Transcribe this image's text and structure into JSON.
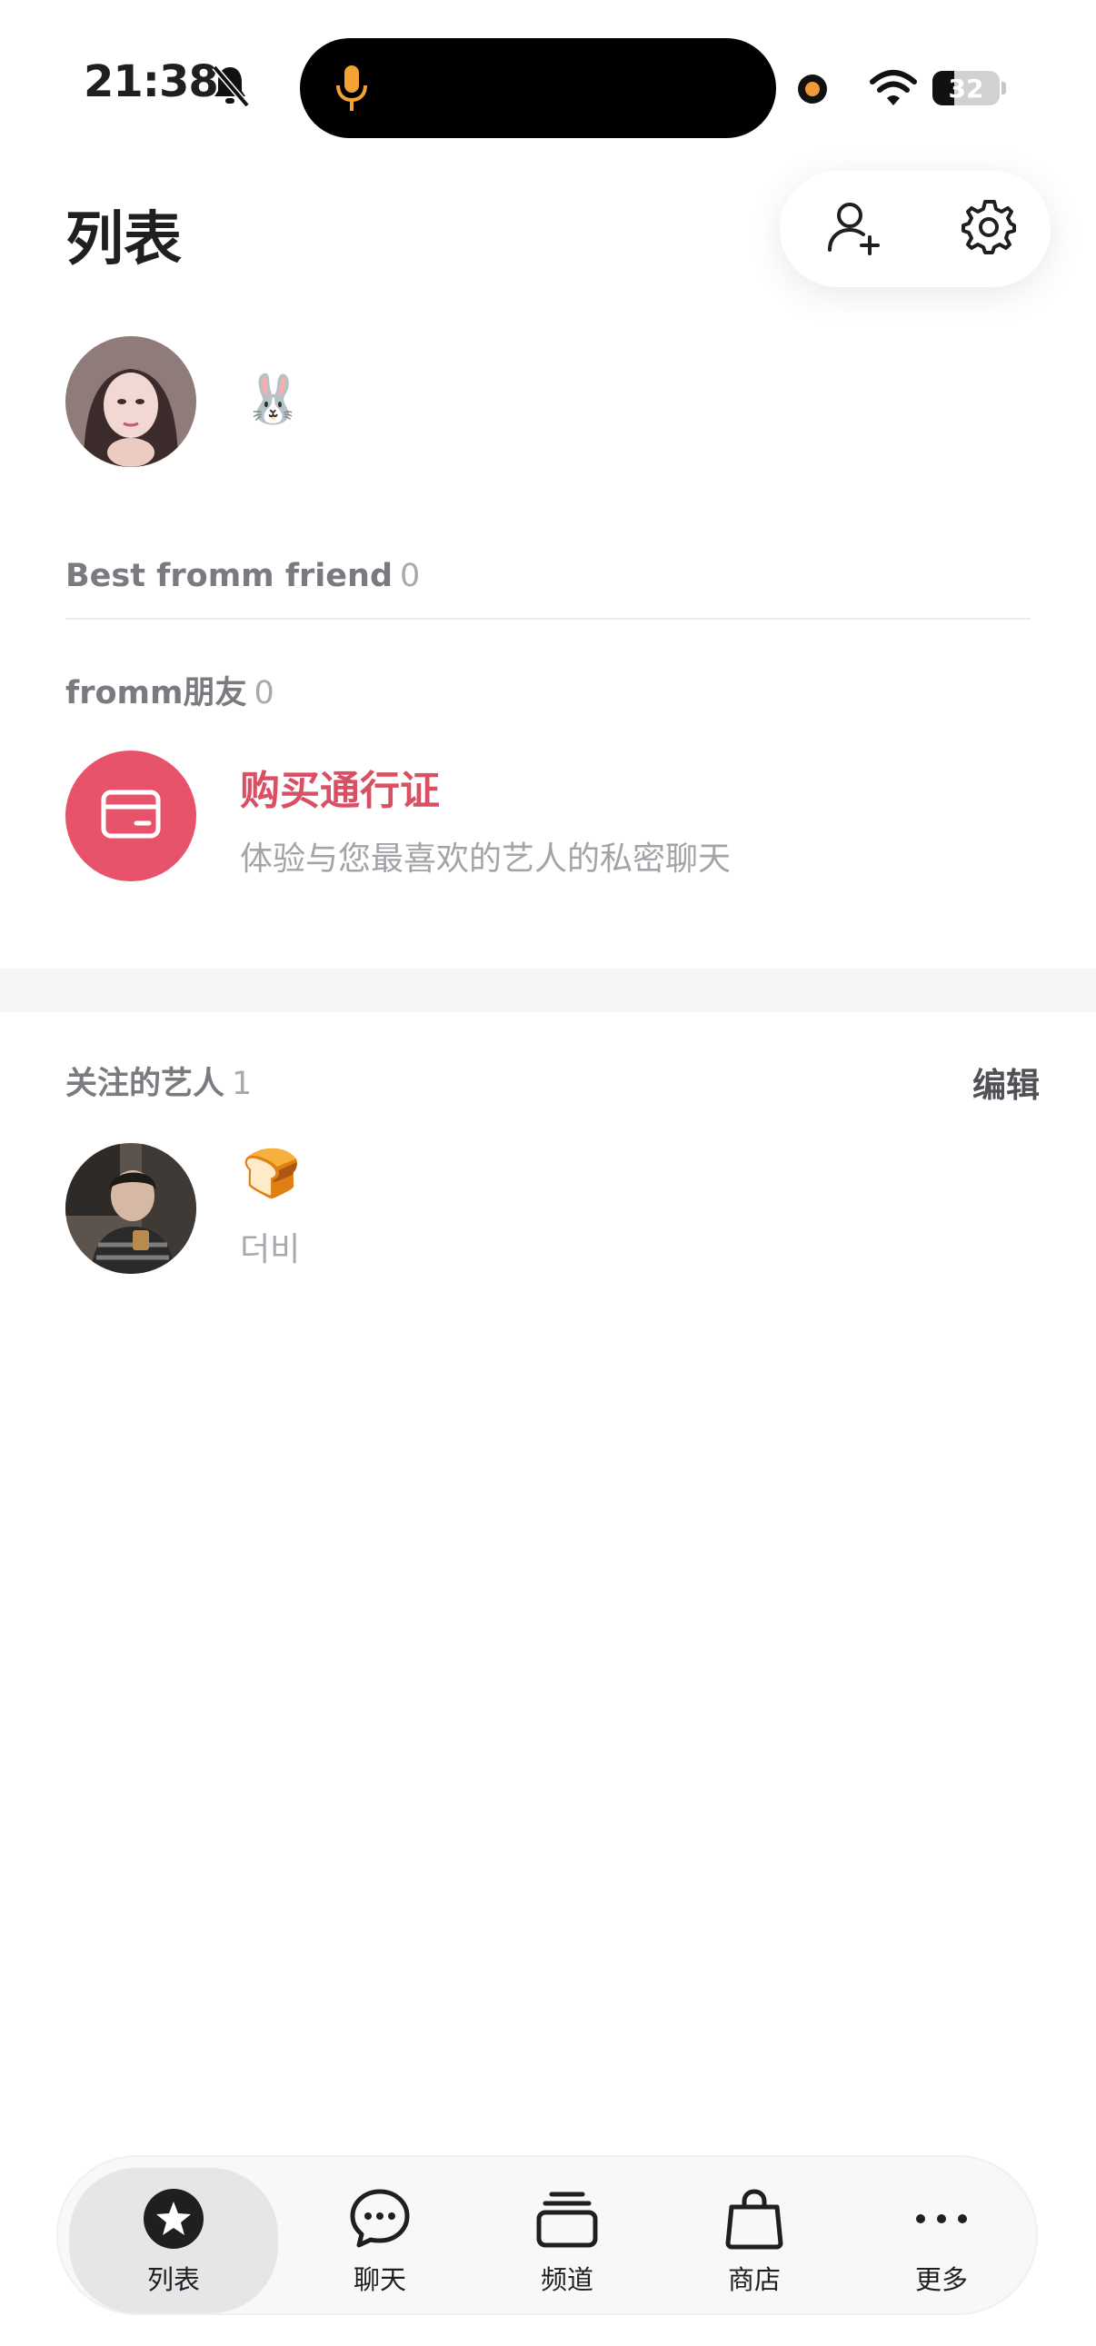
{
  "status_bar": {
    "time": "21:38",
    "battery_level": "32",
    "battery_fraction": 0.32
  },
  "header": {
    "title": "列表"
  },
  "profile": {
    "emoji": "🐰"
  },
  "best_friends": {
    "label": "Best fromm friend",
    "count": "0"
  },
  "friends": {
    "label": "fromm朋友",
    "count": "0"
  },
  "pass_promo": {
    "title": "购买通行证",
    "subtitle": "体验与您最喜欢的艺人的私密聊天"
  },
  "followed_artists": {
    "label": "关注的艺人",
    "count": "1",
    "edit_label": "编辑",
    "items": [
      {
        "emoji": "🍞",
        "name": "더비"
      }
    ]
  },
  "bottom_nav": {
    "items": [
      {
        "label": "列表",
        "icon": "star-icon",
        "active": true
      },
      {
        "label": "聊天",
        "icon": "chat-icon",
        "active": false
      },
      {
        "label": "频道",
        "icon": "channel-icon",
        "active": false
      },
      {
        "label": "商店",
        "icon": "shop-bag-icon",
        "active": false
      },
      {
        "label": "更多",
        "icon": "more-icon",
        "active": false
      }
    ]
  },
  "colors": {
    "accent": "#e8536c",
    "accent_text": "#d94f64"
  }
}
